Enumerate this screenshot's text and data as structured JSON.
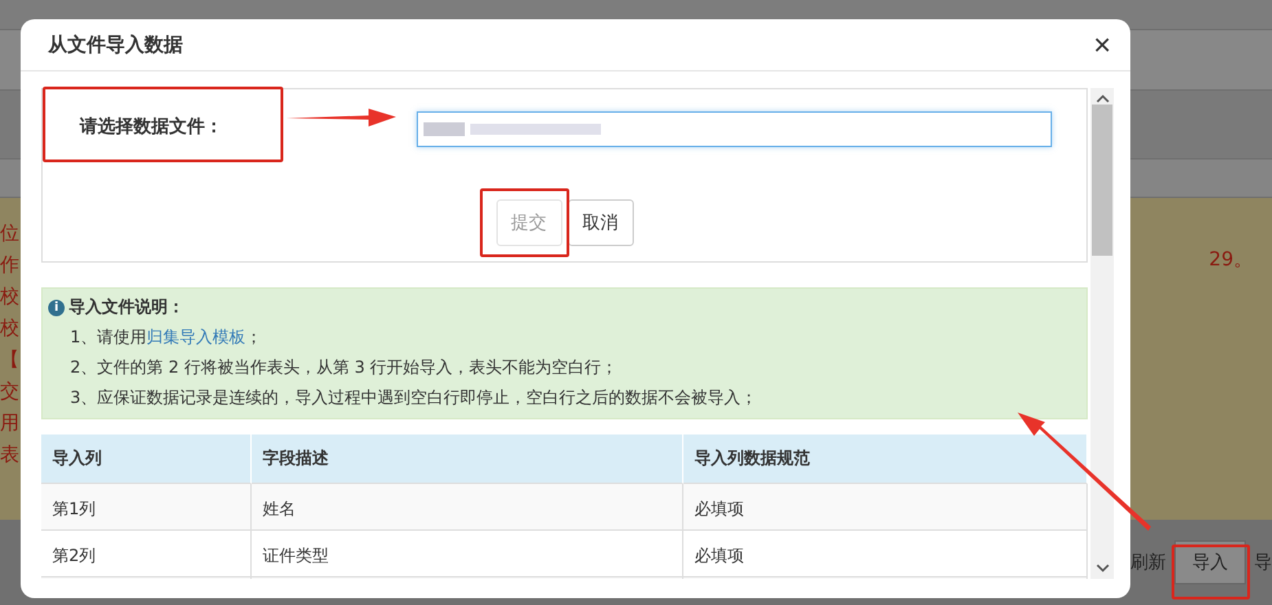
{
  "background_page": {
    "side_fragments": [
      "位",
      "作",
      "校",
      "校",
      "【",
      "交",
      "用",
      "表"
    ],
    "notice_tail": "29。",
    "toolbar": [
      {
        "label": "刷新",
        "kind": "plain"
      },
      {
        "label": "导入",
        "kind": "button"
      },
      {
        "label": "导",
        "kind": "plain"
      }
    ]
  },
  "dialog": {
    "title": "从文件导入数据",
    "close": "×",
    "form": {
      "label": "请选择数据文件：",
      "buttons": [
        {
          "label": "提交",
          "disabled": true
        },
        {
          "label": "取消",
          "disabled": false
        }
      ]
    },
    "info": {
      "icon": "i",
      "title": "导入文件说明：",
      "items": [
        {
          "text": "1、请使用",
          "link": "归集导入模板",
          "after": "；"
        },
        {
          "text": "2、文件的第 2 行将被当作表头，从第 3 行开始导入，表头不能为空白行；"
        },
        {
          "text": "3、应保证数据记录是连续的，导入过程中遇到空白行即停止，空白行之后的数据不会被导入；"
        }
      ]
    },
    "table": {
      "columns": [
        "导入列",
        "字段描述",
        "导入列数据规范"
      ],
      "rows": [
        [
          "第1列",
          "姓名",
          "必填项"
        ],
        [
          "第2列",
          "证件类型",
          "必填项"
        ]
      ]
    }
  }
}
